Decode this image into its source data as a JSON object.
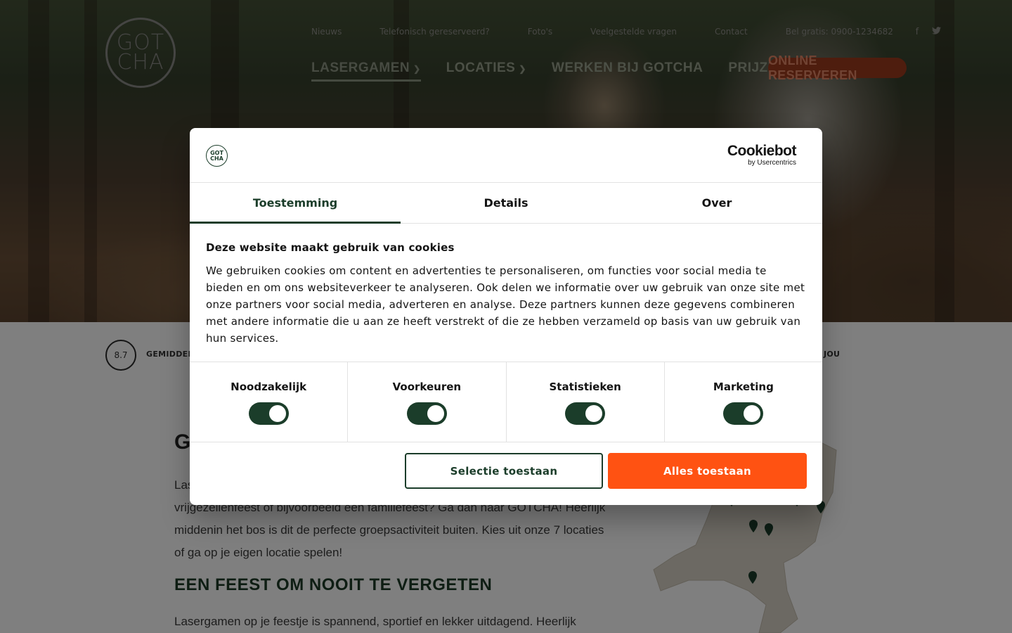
{
  "logo": {
    "line1": "GOT",
    "line2": "CHA"
  },
  "topnav": {
    "links": [
      "Nieuws",
      "Telefonisch gereserveerd?",
      "Foto's",
      "Veelgestelde vragen",
      "Contact"
    ],
    "phone": "Bel gratis: 0900-1234682",
    "social": [
      "facebook-icon",
      "twitter-icon"
    ]
  },
  "mainnav": {
    "items": [
      "Lasergamen",
      "Locaties",
      "Werken bij Gotcha",
      "Prijzen"
    ],
    "cta": "Online reserveren"
  },
  "rating": {
    "score": "8.7",
    "label": "GEMIDDEL",
    "right_label": "JOU"
  },
  "content": {
    "heading_fragment": "G",
    "para_fragment": "Las",
    "para_lines": [
      "vrijgezellenfeest of bijvoorbeeld een familiefeest? Ga dan naar GOTCHA! Heerlijk",
      "middenin het bos is dit de perfecte groepsactiviteit buiten. Kies uit onze 7 locaties",
      "of ga op je eigen locatie spelen!"
    ],
    "h2": "Een feest om nooit te vergeten",
    "para2": "Lasergamen op je feestje is spannend, sportief en lekker uitdagend. Heerlijk"
  },
  "cookie": {
    "brand": "Cookiebot",
    "brand_by": "by Usercentrics",
    "tabs": [
      "Toestemming",
      "Details",
      "Over"
    ],
    "active_tab": "Toestemming",
    "title": "Deze website maakt gebruik van cookies",
    "text": "We gebruiken cookies om content en advertenties te personaliseren, om functies voor social media te bieden en om ons websiteverkeer te analyseren. Ook delen we informatie over uw gebruik van onze site met onze partners voor social media, adverteren en analyse. Deze partners kunnen deze gegevens combineren met andere informatie die u aan ze heeft verstrekt of die ze hebben verzameld op basis van uw gebruik van hun services.",
    "toggles": [
      {
        "label": "Noodzakelijk",
        "on": true
      },
      {
        "label": "Voorkeuren",
        "on": true
      },
      {
        "label": "Statistieken",
        "on": true
      },
      {
        "label": "Marketing",
        "on": true
      }
    ],
    "btn_selection": "Selectie toestaan",
    "btn_all": "Alles toestaan"
  },
  "colors": {
    "brand_green": "#1b3d2a",
    "accent_orange": "#ff5212"
  }
}
